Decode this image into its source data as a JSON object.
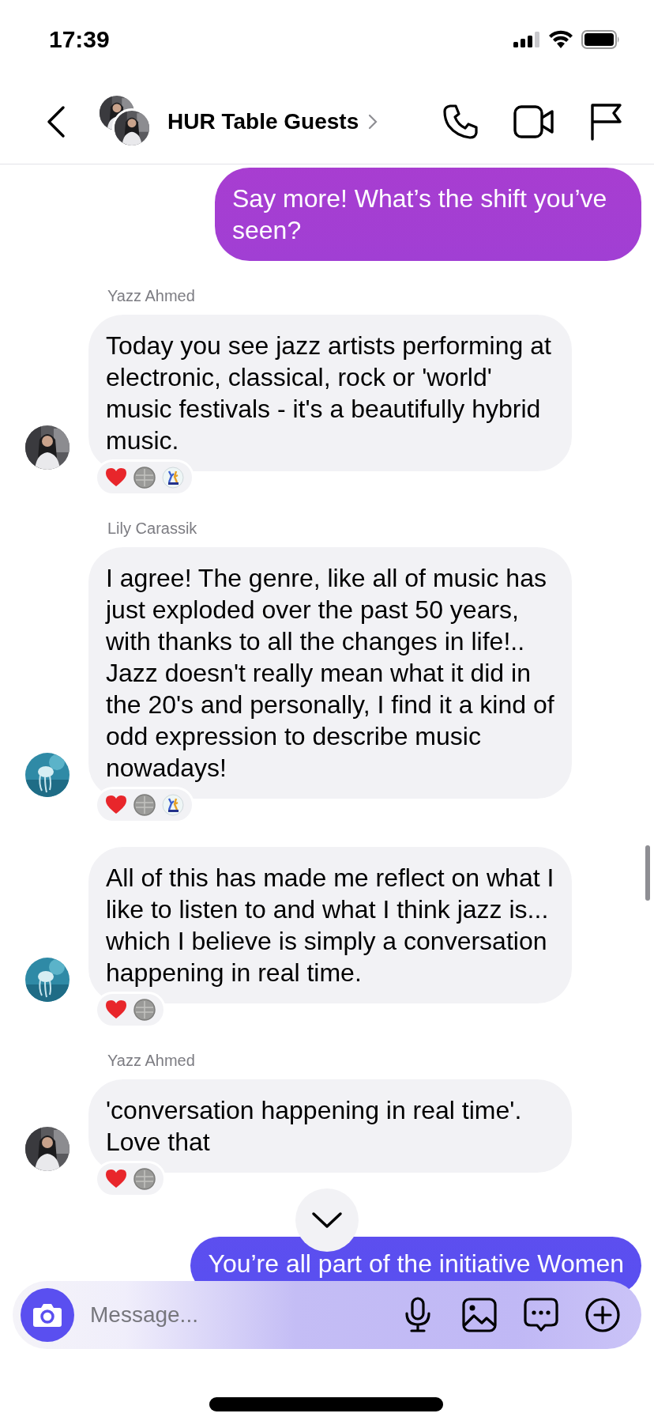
{
  "status_bar": {
    "time": "17:39"
  },
  "header": {
    "title": "HUR Table Guests"
  },
  "messages": [
    {
      "kind": "outgoing",
      "text": "Say more! What’s the shift you’ve seen?"
    },
    {
      "kind": "incoming",
      "sender": "Yazz Ahmed",
      "text": "Today you see jazz artists performing at electronic, classical, rock or 'world' music festivals - it's a beautifully hybrid music.",
      "reactions": [
        {
          "kind": "heart"
        },
        {
          "kind": "coin"
        },
        {
          "kind": "sticker"
        }
      ]
    },
    {
      "kind": "incoming",
      "sender": "Lily Carassik",
      "text": "I agree! The genre, like all of music has just exploded over the past 50 years, with thanks to all the changes in life!.. Jazz doesn't really mean what it did in the 20's and personally, I find it a kind of odd expression to describe music nowadays!",
      "reactions": [
        {
          "kind": "heart"
        },
        {
          "kind": "coin"
        },
        {
          "kind": "sticker"
        }
      ]
    },
    {
      "kind": "incoming",
      "text": "All of this has made me reflect on what I like to listen to and what I think jazz is... which I believe is simply a conversation happening in real time.",
      "reactions": [
        {
          "kind": "heart"
        },
        {
          "kind": "coin"
        }
      ]
    },
    {
      "kind": "incoming",
      "sender": "Yazz Ahmed",
      "text": "'conversation happening in real time'. Love that",
      "reactions": [
        {
          "kind": "heart"
        },
        {
          "kind": "coin"
        }
      ]
    },
    {
      "kind": "outgoing",
      "text": "You’re all part of the initiative Women"
    }
  ],
  "composer": {
    "placeholder": "Message..."
  }
}
